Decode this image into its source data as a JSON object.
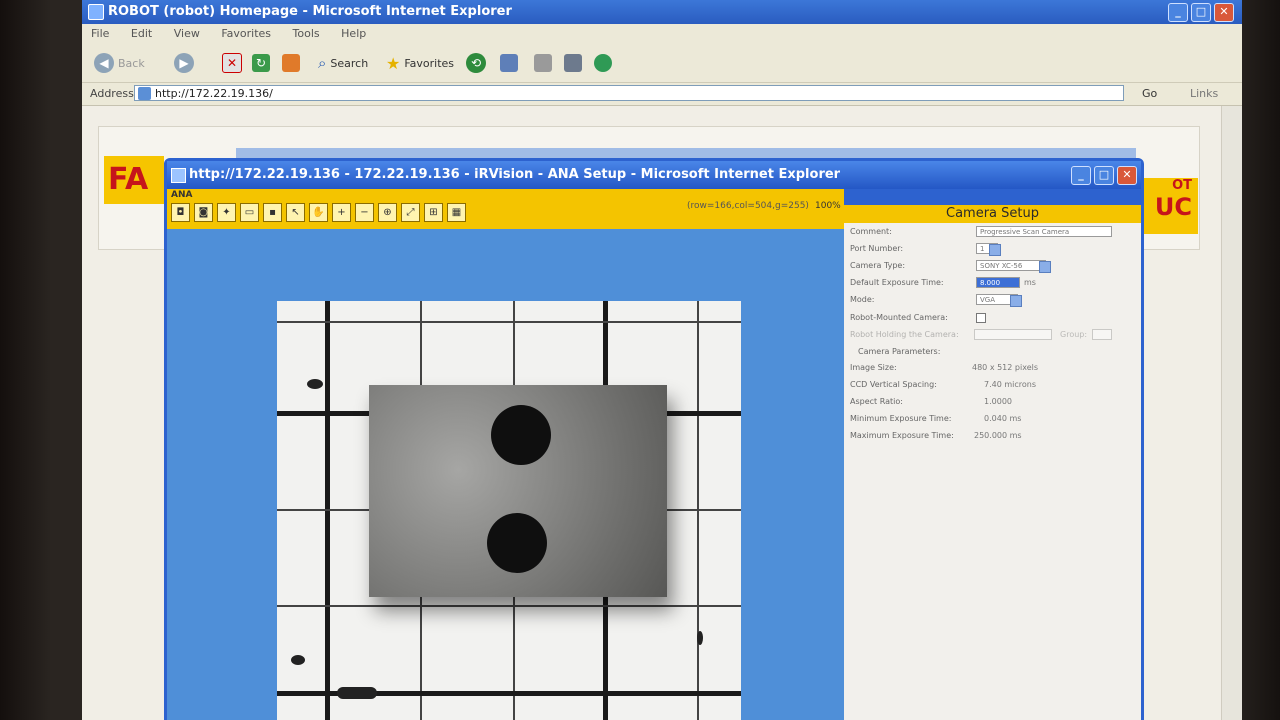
{
  "back_window": {
    "title": "ROBOT (robot) Homepage - Microsoft Internet Explorer",
    "menu": [
      "File",
      "Edit",
      "View",
      "Favorites",
      "Tools",
      "Help"
    ],
    "toolbar": {
      "back": "Back",
      "search": "Search",
      "favorites": "Favorites"
    },
    "address_label": "Address",
    "address_value": "http://172.22.19.136/",
    "go": "Go",
    "links": "Links",
    "brand_left": "FA",
    "brand_right_top": "OT",
    "brand_right_bottom": "UC"
  },
  "front_window": {
    "title": "http://172.22.19.136 - 172.22.19.136 - iRVision - ANA Setup - Microsoft Internet Explorer",
    "app_tag": "ANA",
    "pixel_info": "(row=166,col=504,g=255)",
    "zoom": "100%",
    "setup": {
      "heading": "Camera Setup",
      "fields": {
        "comment_label": "Comment:",
        "comment_value": "Progressive Scan Camera",
        "port_label": "Port Number:",
        "port_value": "1",
        "camera_type_label": "Camera Type:",
        "camera_type_value": "SONY XC-56",
        "exposure_label": "Default Exposure Time:",
        "exposure_value": "8.000",
        "exposure_unit": "ms",
        "mode_label": "Mode:",
        "mode_value": "VGA",
        "robot_mounted_label": "Robot-Mounted Camera:",
        "robot_holding_label": "Robot Holding the Camera:",
        "group_label": "Group:",
        "params_label": "Camera Parameters:",
        "image_size_label": "Image Size:",
        "image_size_value": "480 x 512 pixels",
        "ccd_label": "CCD Vertical Spacing:",
        "ccd_value": "7.40 microns",
        "aspect_label": "Aspect Ratio:",
        "aspect_value": "1.0000",
        "min_exp_label": "Minimum Exposure Time:",
        "min_exp_value": "0.040 ms",
        "max_exp_label": "Maximum Exposure Time:",
        "max_exp_value": "250.000 ms"
      }
    }
  }
}
